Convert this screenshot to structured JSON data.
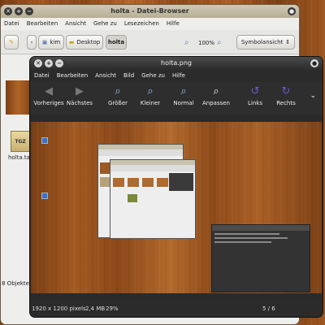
{
  "file_browser": {
    "title": "holta - Datei-Browser",
    "menu": [
      "Datei",
      "Bearbeiten",
      "Ansicht",
      "Gehe zu",
      "Lesezeichen",
      "Hilfe"
    ],
    "path_buttons": [
      "kim",
      "Desktop",
      "holta"
    ],
    "zoom": "100%",
    "view_mode": "Symbolansicht",
    "file_label": "holta.tar.",
    "file_badge": "TGZ",
    "status": "8 Objekte, f"
  },
  "image_viewer": {
    "title": "holta.png",
    "menu": [
      "Datei",
      "Bearbeiten",
      "Ansicht",
      "Bild",
      "Gehe zu",
      "Hilfe"
    ],
    "tools": [
      "Vorheriges",
      "Nächstes",
      "Größer",
      "Kleiner",
      "Normal",
      "Anpassen",
      "Links",
      "Rechts"
    ],
    "status": {
      "dimensions": "1920 x 1200 pixels",
      "size": "2,4 MB",
      "zoom": "29%",
      "position": "5 / 6"
    }
  },
  "colors": {
    "wood_dark": "#7a3e16",
    "wood_light": "#b3672a",
    "viewer_bg": "#2b2b2b",
    "rotate_icon": "#6a5acd"
  }
}
